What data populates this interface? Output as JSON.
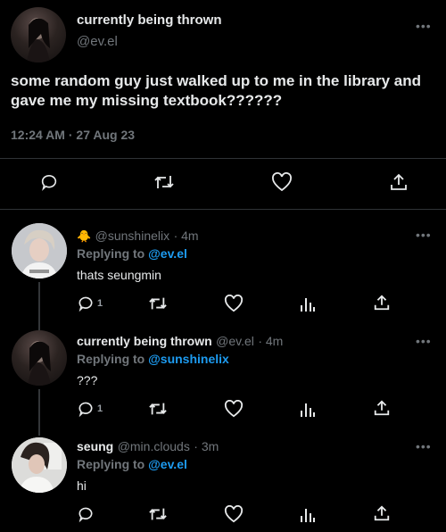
{
  "main_tweet": {
    "display_name": "currently being thrown",
    "handle": "@ev.el",
    "text": "some random guy just walked up to me in the library and gave me my missing textbook??????",
    "time": "12:24 AM",
    "separator": "·",
    "date": "27 Aug 23"
  },
  "replies": [
    {
      "emoji": "🐥",
      "display_name": "",
      "handle": "@sunshinelix",
      "age": "· 4m",
      "replying_label": "Replying to",
      "replying_to": "@ev.el",
      "text": "thats seungmin",
      "reply_count": "1"
    },
    {
      "display_name": "currently being thrown",
      "handle": "@ev.el",
      "age": "· 4m",
      "replying_label": "Replying to",
      "replying_to": "@sunshinelix",
      "text": "???",
      "reply_count": "1"
    },
    {
      "display_name": "seung",
      "handle": "@min.clouds",
      "age": "· 3m",
      "replying_label": "Replying to",
      "replying_to": "@ev.el",
      "text": "hi",
      "reply_count": ""
    }
  ],
  "icons": {
    "more": "more-icon",
    "reply": "reply-icon",
    "retweet": "retweet-icon",
    "like": "like-icon",
    "views": "views-icon",
    "share": "share-icon"
  },
  "more_glyph": "•••",
  "colors": {
    "background": "#000000",
    "text": "#e7e9ea",
    "muted": "#71767b",
    "accent": "#1d9bf0",
    "divider": "#2f3336"
  }
}
